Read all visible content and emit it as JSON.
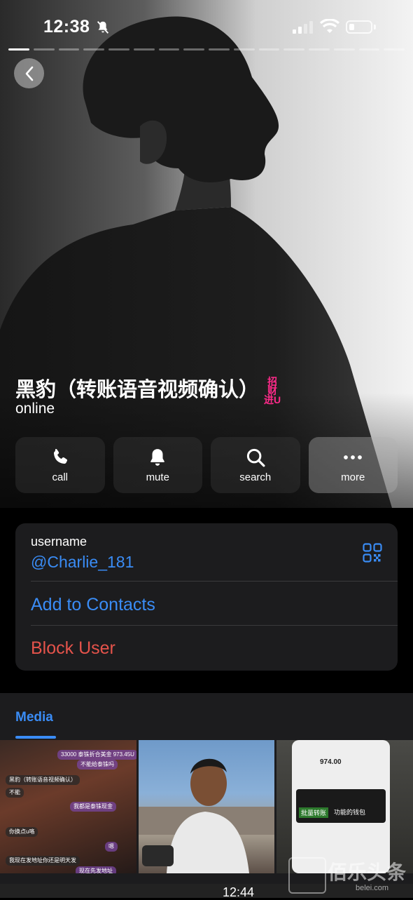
{
  "status_bar": {
    "time": "12:38"
  },
  "profile": {
    "name": "黑豹（转账语音视频确认）",
    "badge_text": "招财\n进U",
    "status": "online"
  },
  "actions": [
    {
      "label": "call",
      "icon": "phone-icon"
    },
    {
      "label": "mute",
      "icon": "bell-icon"
    },
    {
      "label": "search",
      "icon": "search-icon"
    },
    {
      "label": "more",
      "icon": "more-icon"
    }
  ],
  "info": {
    "username_label": "username",
    "username": "@Charlie_181",
    "add_contacts": "Add to Contacts",
    "block_user": "Block User"
  },
  "media": {
    "tab_label": "Media",
    "thumb1_messages": [
      "33000 泰铢折合美金 973.45U",
      "不能给泰铢吗",
      "黑豹（转账语音视频确认）",
      "不能",
      "我都是泰铢现金",
      "你换点u咯",
      "嗯",
      "我现在发地址你还是明天发",
      "现在先发地址"
    ],
    "thumb3_amount": "974.00",
    "thumb3_tag": "批量转账",
    "thumb3_tag2": "功能的钱包",
    "bottom_time": "12:44"
  },
  "watermark": {
    "main": "佰乐头条",
    "small": "belei.com"
  }
}
